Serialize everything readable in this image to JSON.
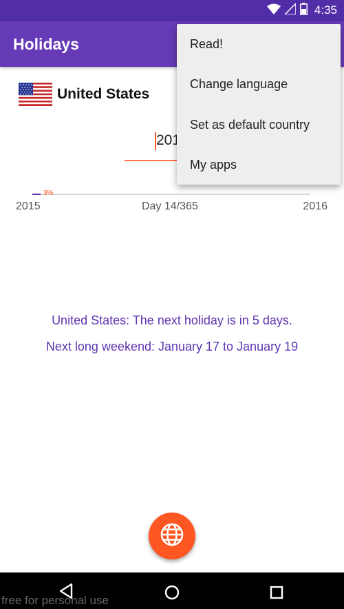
{
  "status_bar": {
    "time": "4:35",
    "icons": [
      "wifi-icon",
      "signal-icon",
      "battery-icon"
    ]
  },
  "app_bar": {
    "title": "Holidays"
  },
  "country": {
    "name": "United States",
    "flag_icon": "us-flag-icon"
  },
  "year_input": {
    "value": "201"
  },
  "progress": {
    "percent_label": "3%",
    "fraction": 0.03,
    "start_label": "2015",
    "day_label": "Day 14/365",
    "end_label": "2016"
  },
  "messages": {
    "next_holiday": "United States: The next holiday is in 5 days.",
    "long_weekend": "Next long weekend: January 17 to January 19"
  },
  "fab": {
    "icon": "globe-icon"
  },
  "overflow_menu": {
    "items": [
      {
        "label": "Read!"
      },
      {
        "label": "Change language"
      },
      {
        "label": "Set as default country"
      },
      {
        "label": "My apps"
      }
    ]
  },
  "nav_bar": {
    "icons": [
      "back-icon",
      "home-icon",
      "recents-icon"
    ]
  },
  "watermark": "free for personal use",
  "colors": {
    "primary": "#673ab7",
    "primary_dark": "#512da8",
    "accent": "#ff5722",
    "message_text": "#5e35b1"
  }
}
